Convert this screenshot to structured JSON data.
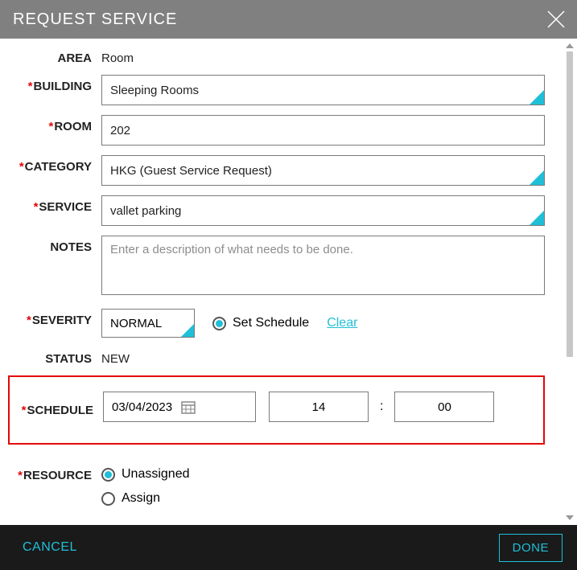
{
  "dialog": {
    "title": "REQUEST SERVICE"
  },
  "labels": {
    "area": "AREA",
    "building": "BUILDING",
    "room": "ROOM",
    "category": "CATEGORY",
    "service": "SERVICE",
    "notes": "NOTES",
    "severity": "SEVERITY",
    "status": "STATUS",
    "schedule": "SCHEDULE",
    "resource": "RESOURCE"
  },
  "values": {
    "area": "Room",
    "building": "Sleeping Rooms",
    "room": "202",
    "category": "HKG (Guest Service Request)",
    "service": "vallet parking",
    "notes_placeholder": "Enter a description of what needs to be done.",
    "severity": "NORMAL",
    "set_schedule_label": "Set Schedule",
    "clear_label": "Clear",
    "status": "NEW",
    "schedule_date": "03/04/2023",
    "schedule_hour": "14",
    "schedule_minute": "00",
    "resource_unassigned": "Unassigned",
    "resource_assign": "Assign"
  },
  "footer": {
    "cancel": "CANCEL",
    "done": "DONE"
  }
}
